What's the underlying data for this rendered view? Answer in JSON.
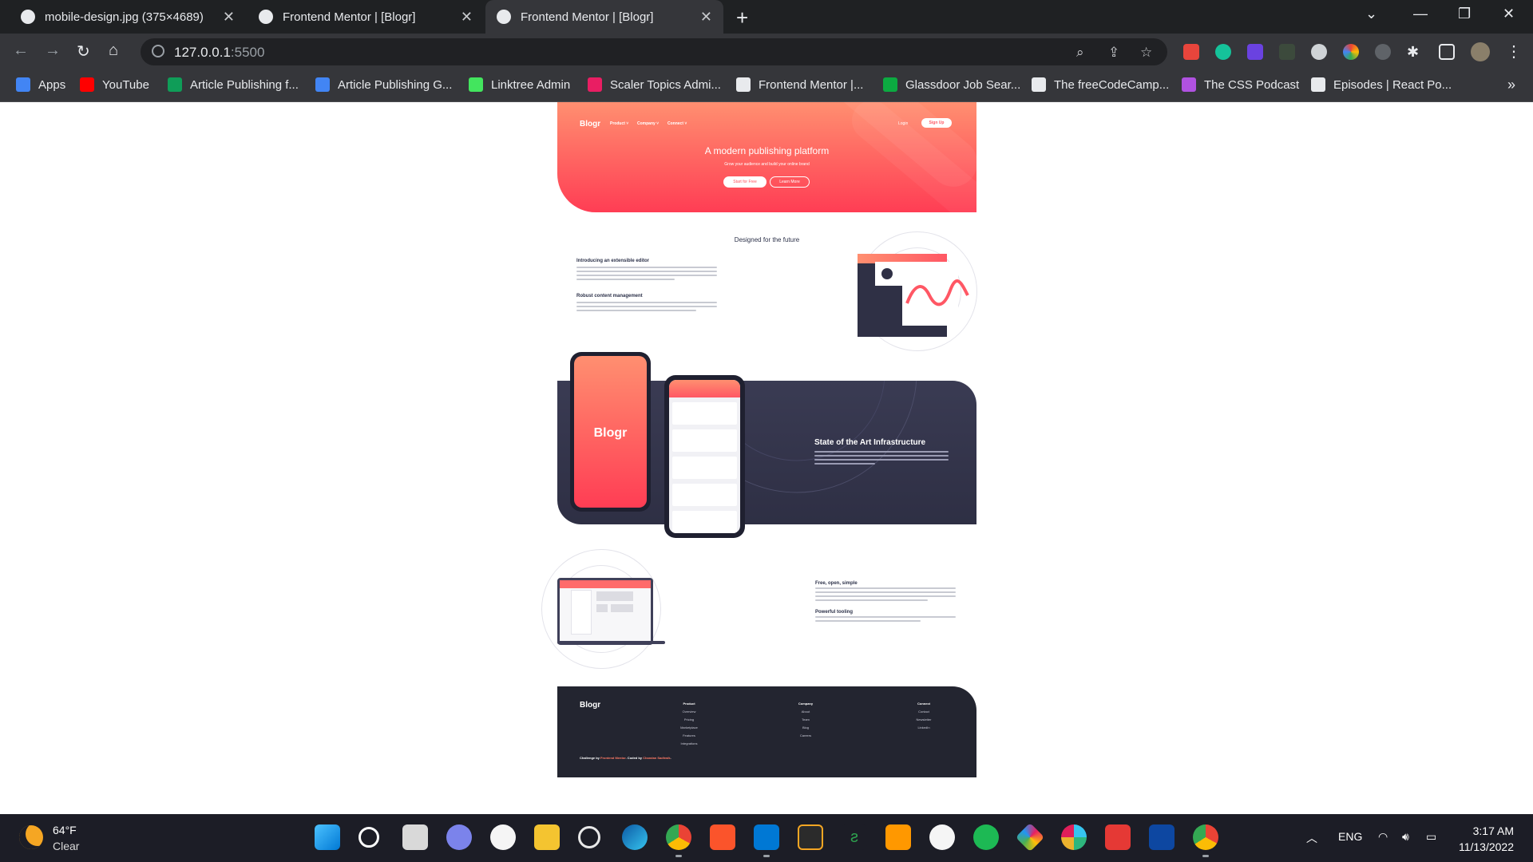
{
  "browser": {
    "tabs": [
      {
        "title": "mobile-design.jpg (375×4689)",
        "active": false
      },
      {
        "title": "Frontend Mentor | [Blogr]",
        "active": false
      },
      {
        "title": "Frontend Mentor | [Blogr]",
        "active": true
      }
    ],
    "url_host": "127.0.0.1",
    "url_port": ":5500",
    "bookmarks": [
      {
        "label": "Apps",
        "color": "#4285f4"
      },
      {
        "label": "YouTube",
        "color": "#ff0000"
      },
      {
        "label": "Article Publishing f...",
        "color": "#0f9d58"
      },
      {
        "label": "Article Publishing G...",
        "color": "#4285f4"
      },
      {
        "label": "Linktree Admin",
        "color": "#43e55e"
      },
      {
        "label": "Scaler Topics Admi...",
        "color": "#e91e63"
      },
      {
        "label": "Frontend Mentor |...",
        "color": "#e8eaed"
      },
      {
        "label": "Glassdoor Job Sear...",
        "color": "#0caa41"
      },
      {
        "label": "The freeCodeCamp...",
        "color": "#e8eaed"
      },
      {
        "label": "The CSS Podcast",
        "color": "#b052e0"
      },
      {
        "label": "Episodes | React Po...",
        "color": "#e8eaed"
      }
    ]
  },
  "site": {
    "logo": "Blogr",
    "nav": [
      "Product ˅",
      "Company ˅",
      "Connect ˅"
    ],
    "login": "Login",
    "signup": "Sign Up",
    "hero_title": "A modern publishing platform",
    "hero_sub": "Grow your audience and build your online brand",
    "btn_start": "Start for Free",
    "btn_learn": "Learn More",
    "section_title": "Designed for the future",
    "feat1_title": "Introducing an extensible editor",
    "feat2_title": "Robust content management",
    "infra_title": "State of the Art Infrastructure",
    "phone_logo": "Blogr",
    "feat3_title": "Free, open, simple",
    "feat4_title": "Powerful tooling",
    "footer": {
      "logo": "Blogr",
      "cols": [
        {
          "head": "Product",
          "items": [
            "Overview",
            "Pricing",
            "Marketplace",
            "Features",
            "Integrations"
          ]
        },
        {
          "head": "Company",
          "items": [
            "About",
            "Team",
            "Blog",
            "Careers"
          ]
        },
        {
          "head": "Connect",
          "items": [
            "Contact",
            "Newsletter",
            "LinkedIn"
          ]
        }
      ],
      "attr_a": "Challenge by ",
      "attr_link1": "Frontend Mentor",
      "attr_b": ". Coded by ",
      "attr_link2": "Chandan Sadhwik",
      "attr_c": "."
    }
  },
  "taskbar": {
    "temp": "64°F",
    "condition": "Clear",
    "lang": "ENG",
    "time": "3:17 AM",
    "date": "11/13/2022"
  },
  "colors": {
    "hero_start": "#ff8f70",
    "hero_end": "#ff3d54",
    "dark_blue": "#2c3149"
  }
}
